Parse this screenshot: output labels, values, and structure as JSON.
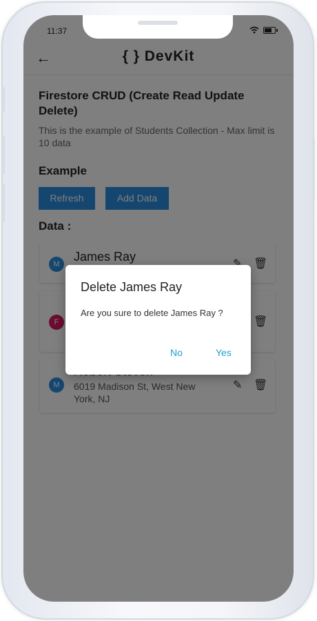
{
  "status": {
    "time": "11:37"
  },
  "appbar": {
    "brand": "{ } DevKit"
  },
  "page": {
    "title": "Firestore CRUD (Create Read Update Delete)",
    "subtitle": "This is the example of Students Collection - Max limit is 10 data",
    "example_heading": "Example",
    "refresh_label": "Refresh",
    "add_label": "Add Data",
    "data_heading": "Data :"
  },
  "records": [
    {
      "initial": "M",
      "name": "James Ray",
      "address": ""
    },
    {
      "initial": "F",
      "name": "",
      "address": ""
    },
    {
      "initial": "M",
      "name": "Robert Steven",
      "address": "6019 Madison St, West New York, NJ"
    }
  ],
  "dialog": {
    "title": "Delete James Ray",
    "message": "Are you sure to delete James Ray ?",
    "no_label": "No",
    "yes_label": "Yes"
  },
  "colors": {
    "primary_button": "#2b8cde",
    "avatar_male": "#2b8cde",
    "avatar_female": "#d81b60",
    "dialog_action": "#1f9fc9"
  },
  "icons": {
    "back": "arrow-left-icon",
    "edit": "pencil-icon",
    "delete": "trash-icon"
  }
}
